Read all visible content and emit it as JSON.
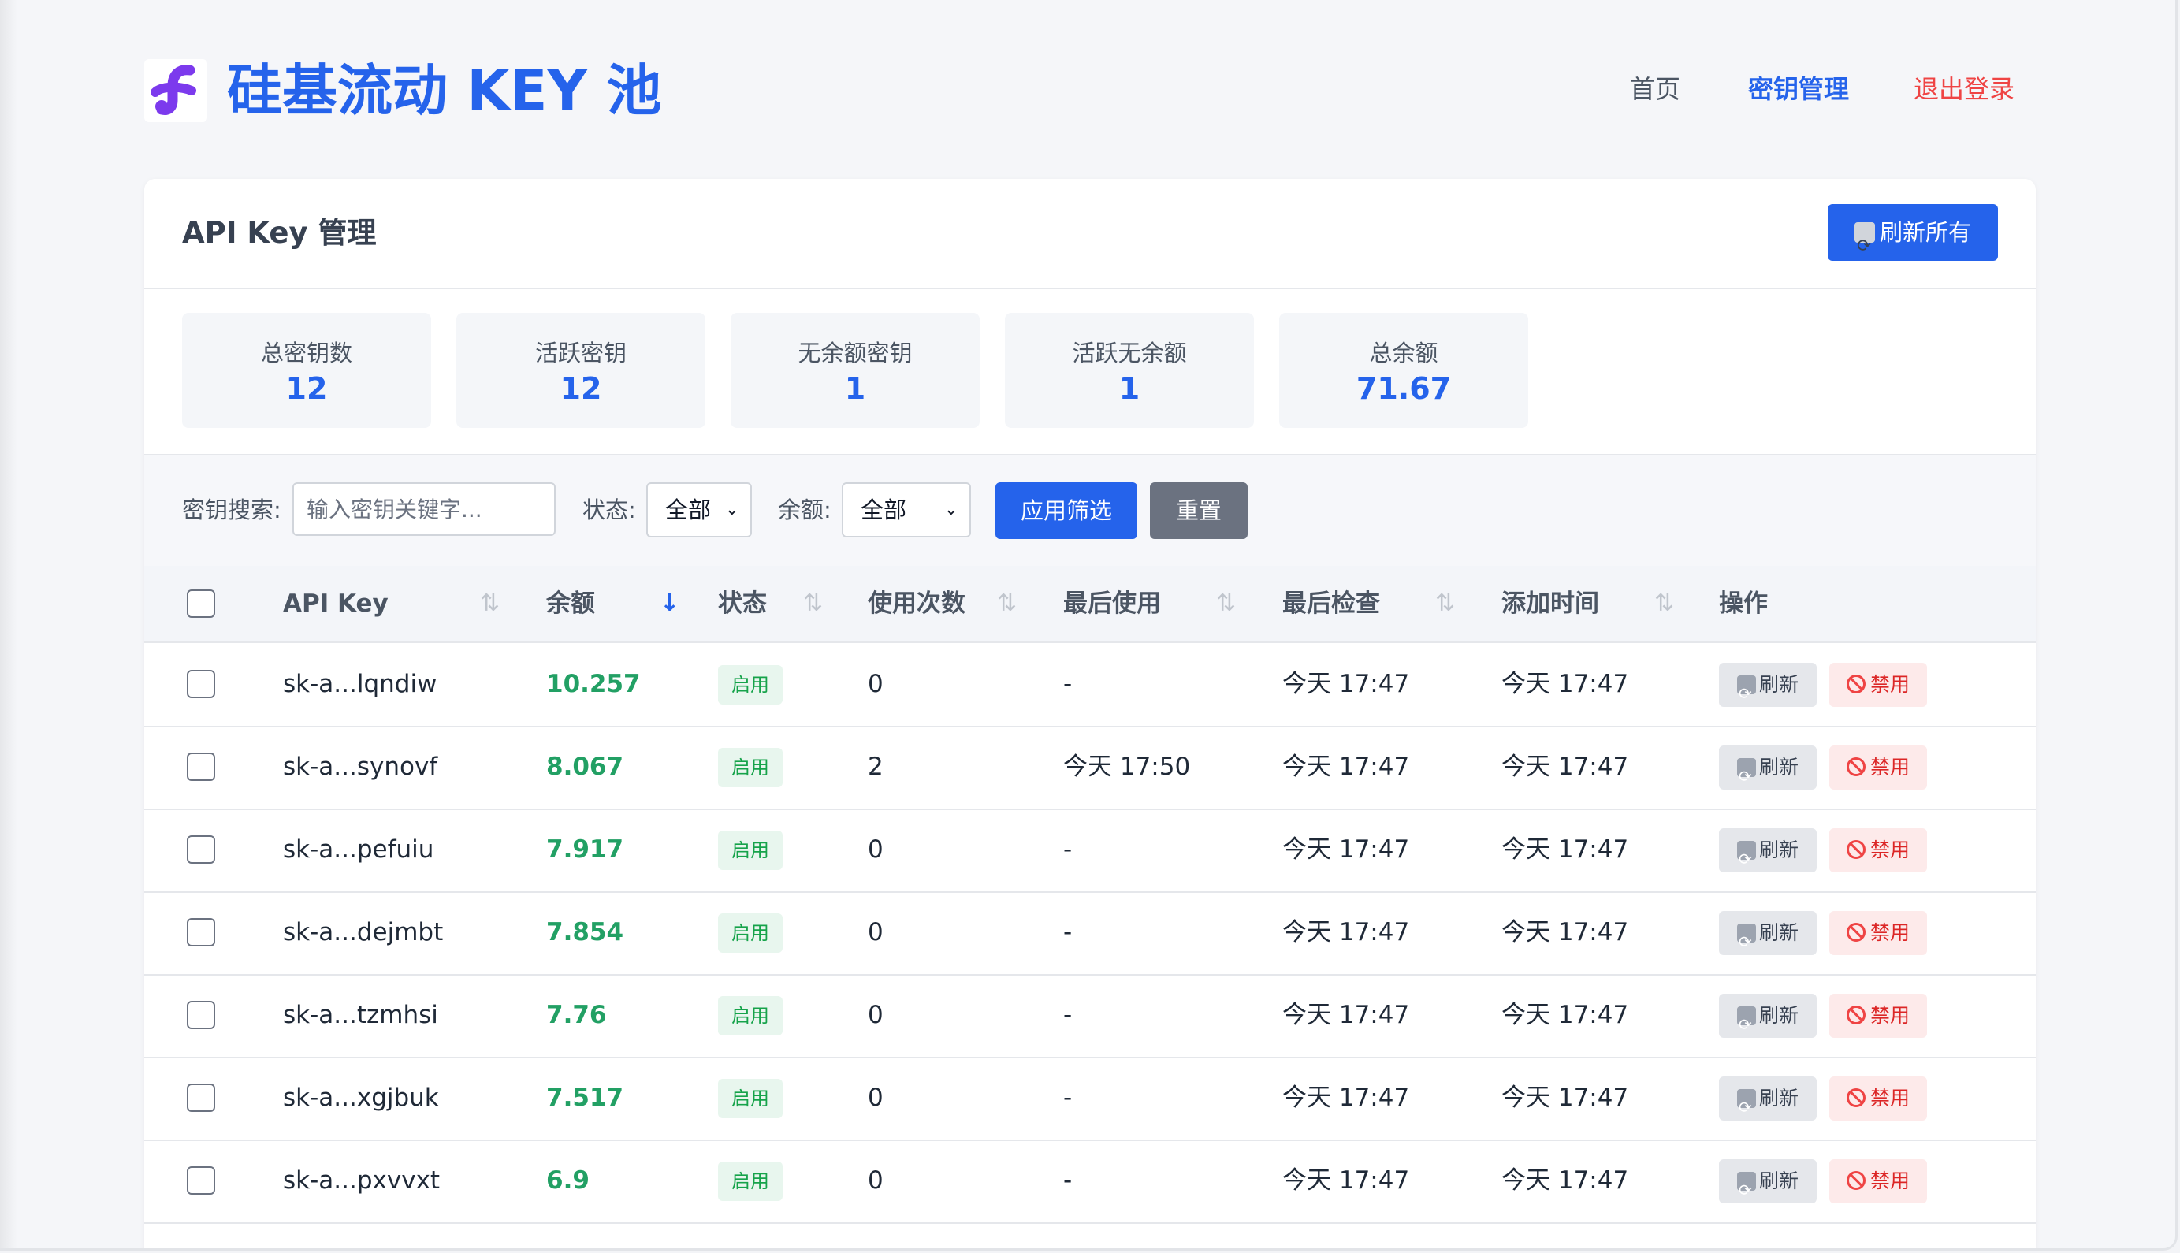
{
  "header": {
    "brand": "硅基流动 KEY 池",
    "nav": {
      "home": "首页",
      "keys": "密钥管理",
      "logout": "退出登录"
    },
    "colors": {
      "accent": "#2563eb",
      "logout": "#ef4444",
      "logo": "#7c3aed"
    }
  },
  "card": {
    "title": "API Key 管理",
    "refresh_all": "刷新所有"
  },
  "stats": [
    {
      "label": "总密钥数",
      "value": "12"
    },
    {
      "label": "活跃密钥",
      "value": "12"
    },
    {
      "label": "无余额密钥",
      "value": "1"
    },
    {
      "label": "活跃无余额",
      "value": "1"
    },
    {
      "label": "总余额",
      "value": "71.67"
    }
  ],
  "filters": {
    "search_label": "密钥搜索:",
    "search_placeholder": "输入密钥关键字...",
    "status_label": "状态:",
    "status_value": "全部",
    "balance_label": "余额:",
    "balance_value": "全部",
    "apply": "应用筛选",
    "reset": "重置"
  },
  "table": {
    "columns": [
      "API Key",
      "余额",
      "状态",
      "使用次数",
      "最后使用",
      "最后检查",
      "添加时间",
      "操作"
    ],
    "sorted_column": "余额",
    "rows": [
      {
        "key": "sk-a...lqndiw",
        "balance": "10.257",
        "status": "启用",
        "uses": "0",
        "last_used": "-",
        "last_check": "今天 17:47",
        "added": "今天 17:47"
      },
      {
        "key": "sk-a...synovf",
        "balance": "8.067",
        "status": "启用",
        "uses": "2",
        "last_used": "今天 17:50",
        "last_check": "今天 17:47",
        "added": "今天 17:47"
      },
      {
        "key": "sk-a...pefuiu",
        "balance": "7.917",
        "status": "启用",
        "uses": "0",
        "last_used": "-",
        "last_check": "今天 17:47",
        "added": "今天 17:47"
      },
      {
        "key": "sk-a...dejmbt",
        "balance": "7.854",
        "status": "启用",
        "uses": "0",
        "last_used": "-",
        "last_check": "今天 17:47",
        "added": "今天 17:47"
      },
      {
        "key": "sk-a...tzmhsi",
        "balance": "7.76",
        "status": "启用",
        "uses": "0",
        "last_used": "-",
        "last_check": "今天 17:47",
        "added": "今天 17:47"
      },
      {
        "key": "sk-a...xgjbuk",
        "balance": "7.517",
        "status": "启用",
        "uses": "0",
        "last_used": "-",
        "last_check": "今天 17:47",
        "added": "今天 17:47"
      },
      {
        "key": "sk-a...pxvvxt",
        "balance": "6.9",
        "status": "启用",
        "uses": "0",
        "last_used": "-",
        "last_check": "今天 17:47",
        "added": "今天 17:47"
      }
    ],
    "row_actions": {
      "refresh": "刷新",
      "disable": "禁用"
    }
  }
}
